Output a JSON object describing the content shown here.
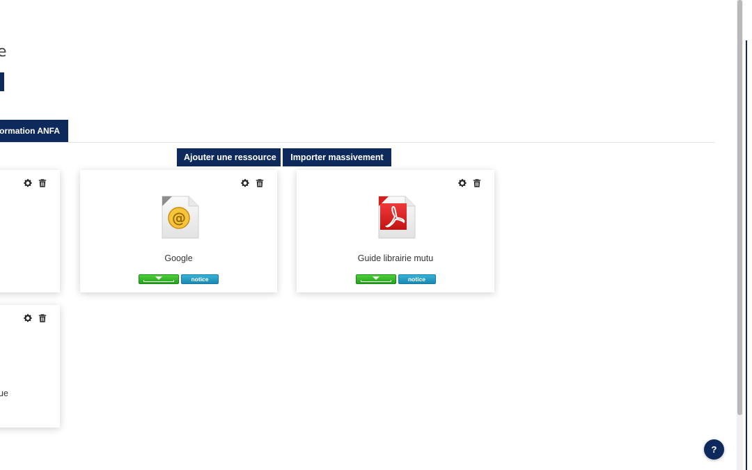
{
  "page": {
    "title_partial": "e"
  },
  "tabs": {
    "active_label": "ormation ANFA"
  },
  "actions": {
    "add_resource": "Ajouter une ressource",
    "bulk_import": "Importer massivement"
  },
  "cards": [
    {
      "title": "",
      "icon": "none"
    },
    {
      "title": "Google",
      "icon": "link-file-icon",
      "download_icon": "download-arrow-icon",
      "notice": "notice"
    },
    {
      "title": "Guide librairie mutu",
      "icon": "pdf-file-icon",
      "download_icon": "download-arrow-icon",
      "notice": "notice"
    },
    {
      "title": "ue",
      "icon": "none"
    }
  ],
  "help": {
    "label": "?"
  },
  "colors": {
    "primary": "#0e2a5c",
    "download_green": "#22a11a",
    "notice_blue": "#1b88b3",
    "pdf_red": "#d62020",
    "link_gold": "#e0a81c"
  }
}
